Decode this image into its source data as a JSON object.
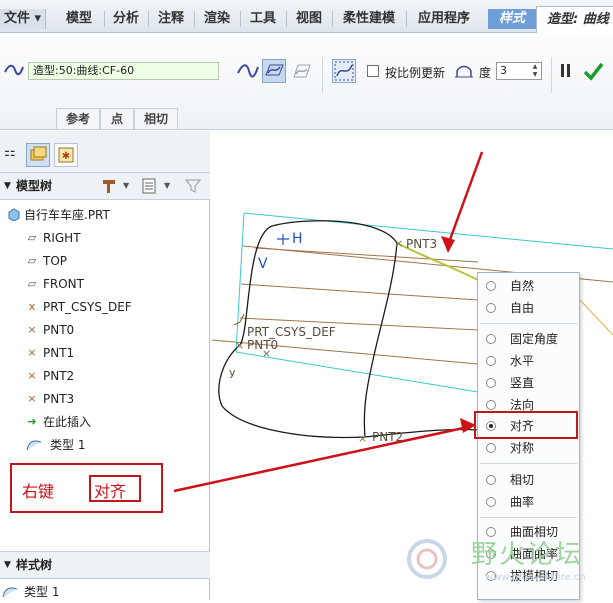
{
  "tabs": {
    "file": "文件",
    "items": [
      "模型",
      "分析",
      "注释",
      "渲染",
      "工具",
      "视图",
      "柔性建模",
      "应用程序"
    ],
    "style": "样式",
    "active": "造型: 曲线"
  },
  "ribbon": {
    "curve_field": "造型:50:曲线:CF-60",
    "proportional_update": "按比例更新",
    "degree_label": "度",
    "degree_value": "3",
    "subtabs": [
      "参考",
      "点",
      "相切"
    ]
  },
  "model_tree": {
    "header": "模型树",
    "items": [
      {
        "label": "自行车车座.PRT",
        "icon": "part-icon"
      },
      {
        "label": "RIGHT",
        "icon": "datum-plane-icon"
      },
      {
        "label": "TOP",
        "icon": "datum-plane-icon"
      },
      {
        "label": "FRONT",
        "icon": "datum-plane-icon"
      },
      {
        "label": "PRT_CSYS_DEF",
        "icon": "csys-icon"
      },
      {
        "label": "PNT0",
        "icon": "datum-point-icon"
      },
      {
        "label": "PNT1",
        "icon": "datum-point-icon"
      },
      {
        "label": "PNT2",
        "icon": "datum-point-icon"
      },
      {
        "label": "PNT3",
        "icon": "datum-point-icon"
      },
      {
        "label": "在此插入",
        "icon": "insert-arrow-icon"
      },
      {
        "label": "类型 1",
        "icon": "style-feature-icon"
      }
    ]
  },
  "style_tree": {
    "header": "样式树",
    "items": [
      "类型 1"
    ]
  },
  "graphics": {
    "labels": [
      "PNT3",
      "PRT_CSYS_DEF",
      "PNT0",
      "PNT2",
      "H",
      "V",
      "y"
    ]
  },
  "context_menu": {
    "items": [
      {
        "label": "自然",
        "checked": false
      },
      {
        "label": "自由",
        "checked": false
      },
      {
        "label": "固定角度",
        "checked": false
      },
      {
        "label": "水平",
        "checked": false
      },
      {
        "label": "竖直",
        "checked": false
      },
      {
        "label": "法向",
        "checked": false
      },
      {
        "label": "对齐",
        "checked": true
      },
      {
        "label": "对称",
        "checked": false
      },
      {
        "label": "相切",
        "checked": false
      },
      {
        "label": "曲率",
        "checked": false
      },
      {
        "label": "曲面相切",
        "checked": false
      },
      {
        "label": "曲面曲率",
        "checked": false
      },
      {
        "label": "拔模相切",
        "checked": false
      }
    ]
  },
  "annotation": {
    "text1": "右键",
    "text2": "对齐"
  },
  "watermark": {
    "text": "野火论坛",
    "url": "www.proewildfire.cn"
  },
  "colors": {
    "accent_red": "#c0161c",
    "ok_green": "#1a9a2a",
    "tab_blue": "#6f9fd8"
  }
}
